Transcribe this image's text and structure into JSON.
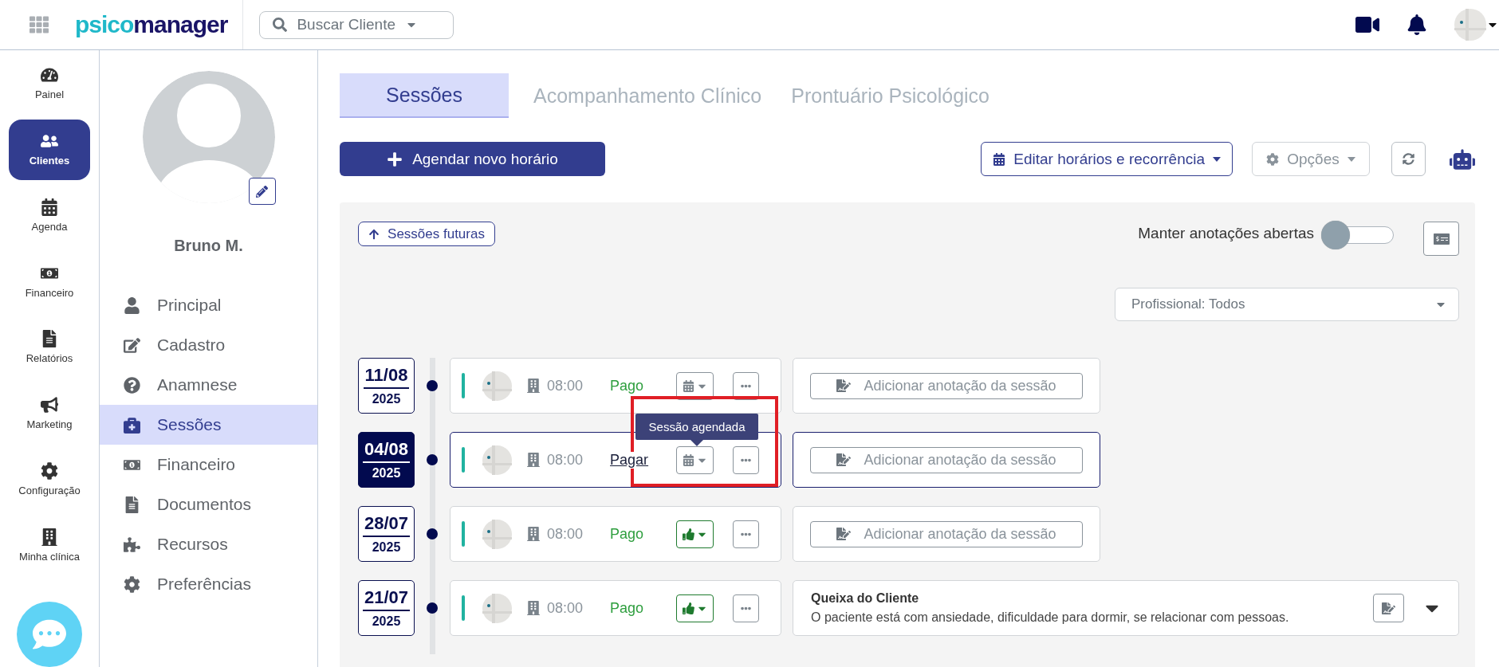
{
  "top_bar": {
    "logo": [
      "psico",
      "manager"
    ],
    "search": {
      "placeholder": "Buscar Cliente"
    }
  },
  "rail": [
    {
      "label": "Painel",
      "selected": false
    },
    {
      "label": "Clientes",
      "selected": true
    },
    {
      "label": "Agenda",
      "selected": false
    },
    {
      "label": "Financeiro",
      "selected": false
    },
    {
      "label": "Relatórios",
      "selected": false
    },
    {
      "label": "Marketing",
      "selected": false
    },
    {
      "label": "Configuração",
      "selected": false
    },
    {
      "label": "Minha clínica",
      "selected": false
    }
  ],
  "client": {
    "name": "Bruno M.",
    "menu": [
      {
        "label": "Principal",
        "selected": false
      },
      {
        "label": "Cadastro",
        "selected": false
      },
      {
        "label": "Anamnese",
        "selected": false
      },
      {
        "label": "Sessões",
        "selected": true
      },
      {
        "label": "Financeiro",
        "selected": false
      },
      {
        "label": "Documentos",
        "selected": false
      },
      {
        "label": "Recursos",
        "selected": false
      },
      {
        "label": "Preferências",
        "selected": false
      }
    ]
  },
  "tabs": [
    {
      "label": "Sessões",
      "selected": true
    },
    {
      "label": "Acompanhamento Clínico",
      "selected": false
    },
    {
      "label": "Prontuário Psicológico",
      "selected": false
    }
  ],
  "actions": {
    "new_slot": "Agendar novo horário",
    "edit_schedule": "Editar horários e recorrência",
    "options": "Opções"
  },
  "panel": {
    "future_sessions": "Sessões futuras",
    "keep_notes": {
      "label": "Manter anotações abertas",
      "on": false
    },
    "professional_filter": {
      "value": "Profissional: Todos"
    }
  },
  "sessions": [
    {
      "date": "11/08",
      "year": "2025",
      "time": "08:00",
      "selected": false,
      "payment": {
        "kind": "paid",
        "label": "Pago"
      },
      "status": {
        "kind": "scheduled"
      },
      "annotation": {
        "kind": "add",
        "label": "Adicionar anotação da sessão"
      }
    },
    {
      "date": "04/08",
      "year": "2025",
      "time": "08:00",
      "selected": true,
      "payment": {
        "kind": "pay",
        "label": "Pagar"
      },
      "status": {
        "kind": "scheduled",
        "tooltip": "Sessão agendada"
      },
      "annotation": {
        "kind": "add",
        "label": "Adicionar anotação da sessão"
      }
    },
    {
      "date": "28/07",
      "year": "2025",
      "time": "08:00",
      "selected": false,
      "payment": {
        "kind": "paid",
        "label": "Pago"
      },
      "status": {
        "kind": "confirmed"
      },
      "annotation": {
        "kind": "add",
        "label": "Adicionar anotação da sessão"
      }
    },
    {
      "date": "21/07",
      "year": "2025",
      "time": "08:00",
      "selected": false,
      "payment": {
        "kind": "paid",
        "label": "Pago"
      },
      "status": {
        "kind": "confirmed"
      },
      "annotation": {
        "kind": "note",
        "title": "Queixa do Cliente",
        "text": "O paciente está com ansiedade, dificuldade para dormir, se relacionar com pessoas."
      }
    }
  ]
}
